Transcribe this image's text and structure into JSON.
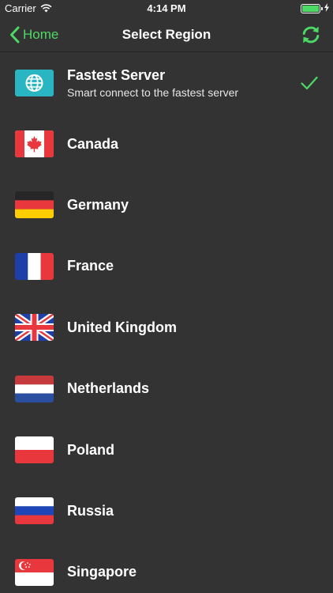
{
  "status_bar": {
    "carrier": "Carrier",
    "time": "4:14 PM",
    "battery_level": 1.0,
    "battery_color": "#4cd964"
  },
  "nav": {
    "back_label": "Home",
    "title": "Select Region",
    "back_icon": "chevron-left-icon",
    "refresh_icon": "refresh-icon",
    "accent_color": "#4cd964"
  },
  "regions": [
    {
      "name": "Fastest Server",
      "subtitle": "Smart connect to the fastest server",
      "icon": "globe-icon",
      "selected": true
    },
    {
      "name": "Canada",
      "icon": "flag-canada-icon",
      "selected": false
    },
    {
      "name": "Germany",
      "icon": "flag-germany-icon",
      "selected": false
    },
    {
      "name": "France",
      "icon": "flag-france-icon",
      "selected": false
    },
    {
      "name": "United Kingdom",
      "icon": "flag-uk-icon",
      "selected": false
    },
    {
      "name": "Netherlands",
      "icon": "flag-netherlands-icon",
      "selected": false
    },
    {
      "name": "Poland",
      "icon": "flag-poland-icon",
      "selected": false
    },
    {
      "name": "Russia",
      "icon": "flag-russia-icon",
      "selected": false
    },
    {
      "name": "Singapore",
      "icon": "flag-singapore-icon",
      "selected": false
    }
  ]
}
